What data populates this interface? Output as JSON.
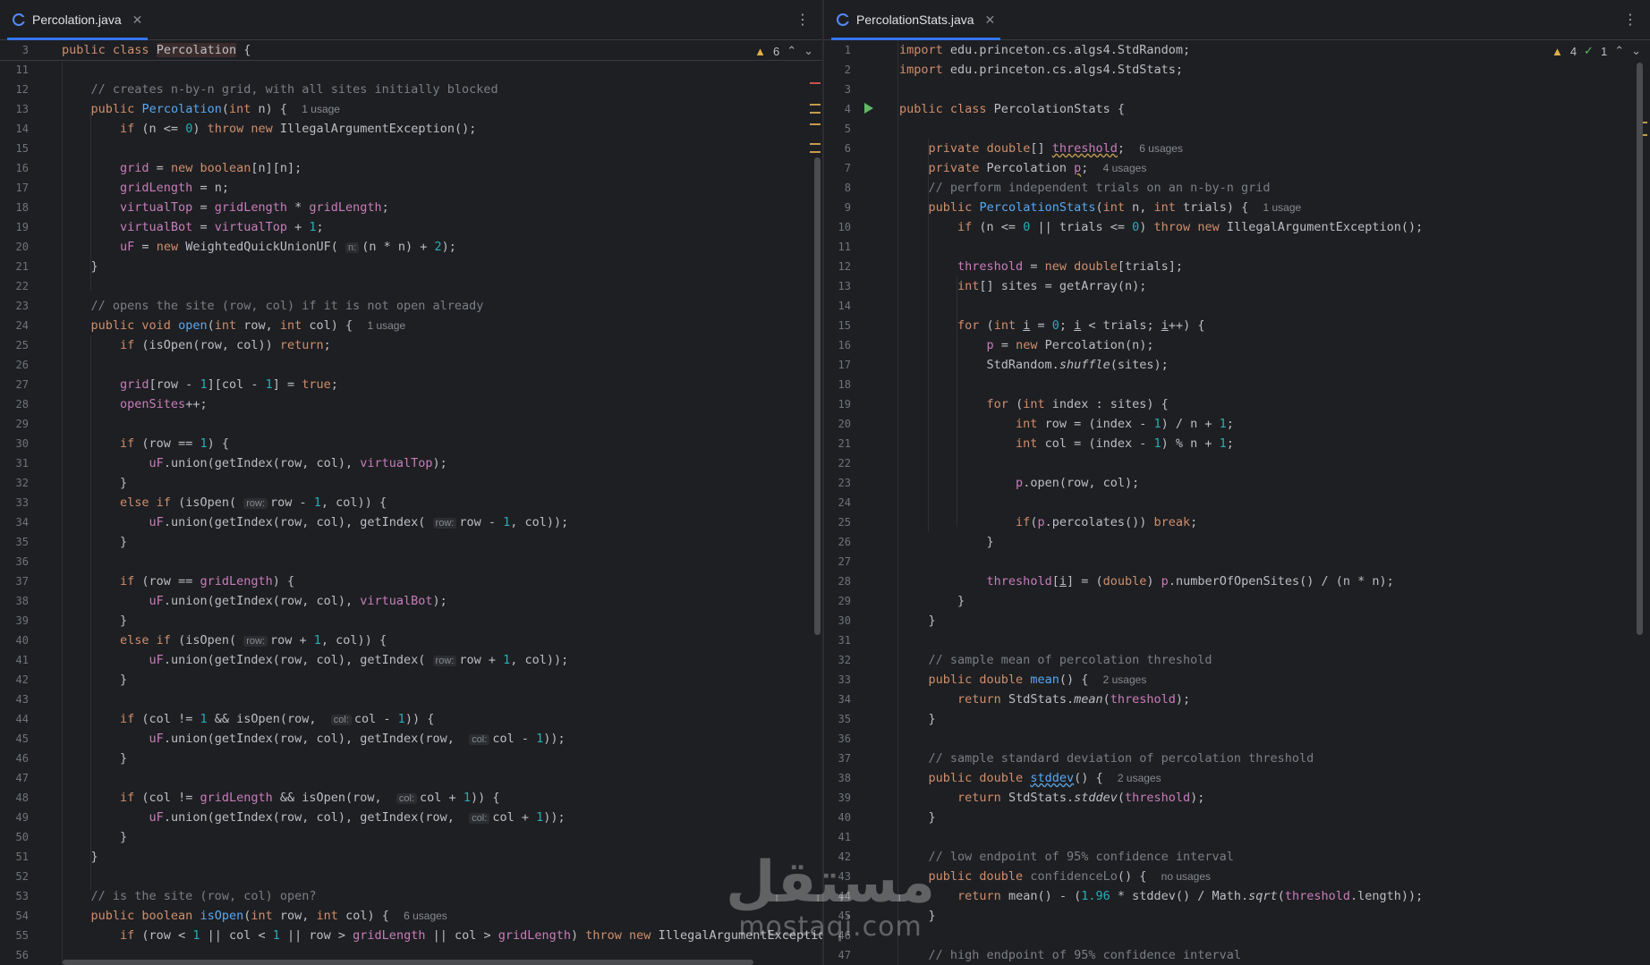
{
  "left": {
    "tab_title": "Percolation.java",
    "sticky_line_no": "3",
    "warnings": "6",
    "lines": [
      {
        "n": "11",
        "html": ""
      },
      {
        "n": "12",
        "html": "    <span class='cm'>// creates n-by-n grid, with all sites initially blocked</span>"
      },
      {
        "n": "13",
        "html": "    <span class='kw'>public</span> <span class='fn'>Percolation</span>(<span class='ty'>int</span> n) {  <span class='hint'>1 usage</span>"
      },
      {
        "n": "14",
        "html": "        <span class='kw'>if</span> (n &lt;= <span class='num'>0</span>) <span class='kw'>throw new</span> IllegalArgumentException();"
      },
      {
        "n": "15",
        "html": ""
      },
      {
        "n": "16",
        "html": "        <span class='fld'>grid</span> = <span class='kw'>new</span> <span class='ty'>boolean</span>[n][n];"
      },
      {
        "n": "17",
        "html": "        <span class='fld'>gridLength</span> = n;"
      },
      {
        "n": "18",
        "html": "        <span class='fld'>virtualTop</span> = <span class='fld'>gridLength</span> * <span class='fld'>gridLength</span>;"
      },
      {
        "n": "19",
        "html": "        <span class='fld'>virtualBot</span> = <span class='fld'>virtualTop</span> + <span class='num'>1</span>;"
      },
      {
        "n": "20",
        "html": "        <span class='fld'>uF</span> = <span class='kw'>new</span> WeightedQuickUnionUF( <span class='inl'>n:</span>(n * n) + <span class='num'>2</span>);"
      },
      {
        "n": "21",
        "html": "    }"
      },
      {
        "n": "22",
        "html": ""
      },
      {
        "n": "23",
        "html": "    <span class='cm'>// opens the site (row, col) if it is not open already</span>"
      },
      {
        "n": "24",
        "html": "    <span class='kw'>public void</span> <span class='fn'>open</span>(<span class='ty'>int</span> row, <span class='ty'>int</span> col) {  <span class='hint'>1 usage</span>"
      },
      {
        "n": "25",
        "html": "        <span class='kw'>if</span> (isOpen(row, col)) <span class='kw'>return</span>;"
      },
      {
        "n": "26",
        "html": ""
      },
      {
        "n": "27",
        "html": "        <span class='fld'>grid</span>[row - <span class='num'>1</span>][col - <span class='num'>1</span>] = <span class='kw'>true</span>;"
      },
      {
        "n": "28",
        "html": "        <span class='fld'>openSites</span>++;"
      },
      {
        "n": "29",
        "html": ""
      },
      {
        "n": "30",
        "html": "        <span class='kw'>if</span> (row == <span class='num'>1</span>) {"
      },
      {
        "n": "31",
        "html": "            <span class='fld'>uF</span>.union(getIndex(row, col), <span class='fld'>virtualTop</span>);"
      },
      {
        "n": "32",
        "html": "        }"
      },
      {
        "n": "33",
        "html": "        <span class='kw'>else if</span> (isOpen( <span class='inl'>row:</span>row - <span class='num'>1</span>, col)) {"
      },
      {
        "n": "34",
        "html": "            <span class='fld'>uF</span>.union(getIndex(row, col), getIndex( <span class='inl'>row:</span>row - <span class='num'>1</span>, col));"
      },
      {
        "n": "35",
        "html": "        }"
      },
      {
        "n": "36",
        "html": ""
      },
      {
        "n": "37",
        "html": "        <span class='kw'>if</span> (row == <span class='fld'>gridLength</span>) {"
      },
      {
        "n": "38",
        "html": "            <span class='fld'>uF</span>.union(getIndex(row, col), <span class='fld'>virtualBot</span>);"
      },
      {
        "n": "39",
        "html": "        }"
      },
      {
        "n": "40",
        "html": "        <span class='kw'>else if</span> (isOpen( <span class='inl'>row:</span>row + <span class='num'>1</span>, col)) {"
      },
      {
        "n": "41",
        "html": "            <span class='fld'>uF</span>.union(getIndex(row, col), getIndex( <span class='inl'>row:</span>row + <span class='num'>1</span>, col));"
      },
      {
        "n": "42",
        "html": "        }"
      },
      {
        "n": "43",
        "html": ""
      },
      {
        "n": "44",
        "html": "        <span class='kw'>if</span> (col != <span class='num'>1</span> &amp;&amp; isOpen(row,  <span class='inl'>col:</span>col - <span class='num'>1</span>)) {"
      },
      {
        "n": "45",
        "html": "            <span class='fld'>uF</span>.union(getIndex(row, col), getIndex(row,  <span class='inl'>col:</span>col - <span class='num'>1</span>));"
      },
      {
        "n": "46",
        "html": "        }"
      },
      {
        "n": "47",
        "html": ""
      },
      {
        "n": "48",
        "html": "        <span class='kw'>if</span> (col != <span class='fld'>gridLength</span> &amp;&amp; isOpen(row,  <span class='inl'>col:</span>col + <span class='num'>1</span>)) {"
      },
      {
        "n": "49",
        "html": "            <span class='fld'>uF</span>.union(getIndex(row, col), getIndex(row,  <span class='inl'>col:</span>col + <span class='num'>1</span>));"
      },
      {
        "n": "50",
        "html": "        }"
      },
      {
        "n": "51",
        "html": "    }"
      },
      {
        "n": "52",
        "html": ""
      },
      {
        "n": "53",
        "html": "    <span class='cm'>// is the site (row, col) open?</span>"
      },
      {
        "n": "54",
        "html": "    <span class='kw'>public boolean</span> <span class='fn'>isOpen</span>(<span class='ty'>int</span> row, <span class='ty'>int</span> col) {  <span class='hint'>6 usages</span>"
      },
      {
        "n": "55",
        "html": "        <span class='kw'>if</span> (row &lt; <span class='num'>1</span> || col &lt; <span class='num'>1</span> || row &gt; <span class='fld'>gridLength</span> || col &gt; <span class='fld'>gridLength</span>) <span class='kw'>throw new</span> IllegalArgumentException"
      },
      {
        "n": "56",
        "html": ""
      }
    ]
  },
  "right": {
    "tab_title": "PercolationStats.java",
    "warnings": "4",
    "checks": "1",
    "lines": [
      {
        "n": "1",
        "html": "<span class='kw'>import</span> edu.princeton.cs.algs4.StdRandom;"
      },
      {
        "n": "2",
        "html": "<span class='kw'>import</span> edu.princeton.cs.algs4.StdStats;"
      },
      {
        "n": "3",
        "html": ""
      },
      {
        "n": "4",
        "html": "<span class='kw'>public class</span> PercolationStats {"
      },
      {
        "n": "5",
        "html": ""
      },
      {
        "n": "6",
        "html": "    <span class='kw'>private</span> <span class='ty'>double</span>[] <span class='fld warnul'>threshold</span>;  <span class='hint'>6 usages</span>"
      },
      {
        "n": "7",
        "html": "    <span class='kw'>private</span> Percolation <span class='fld warnul'>p</span>;  <span class='hint'>4 usages</span>"
      },
      {
        "n": "8",
        "html": "    <span class='cm'>// perform independent trials on an n-by-n grid</span>"
      },
      {
        "n": "9",
        "html": "    <span class='kw'>public</span> <span class='fn'>PercolationStats</span>(<span class='ty'>int</span> n, <span class='ty'>int</span> trials) {  <span class='hint'>1 usage</span>"
      },
      {
        "n": "10",
        "html": "        <span class='kw'>if</span> (n &lt;= <span class='num'>0</span> || trials &lt;= <span class='num'>0</span>) <span class='kw'>throw new</span> IllegalArgumentException();"
      },
      {
        "n": "11",
        "html": ""
      },
      {
        "n": "12",
        "html": "        <span class='fld'>threshold</span> = <span class='kw'>new</span> <span class='ty'>double</span>[trials];"
      },
      {
        "n": "13",
        "html": "        <span class='ty'>int</span>[] sites = getArray(n);"
      },
      {
        "n": "14",
        "html": ""
      },
      {
        "n": "15",
        "html": "        <span class='kw'>for</span> (<span class='ty'>int</span> <span class='ul'>i</span> = <span class='num'>0</span>; <span class='ul'>i</span> &lt; trials; <span class='ul'>i</span>++) {"
      },
      {
        "n": "16",
        "html": "            <span class='fld'>p</span> = <span class='kw'>new</span> Percolation(n);"
      },
      {
        "n": "17",
        "html": "            StdRandom.<span class='it'>shuffle</span>(sites);"
      },
      {
        "n": "18",
        "html": ""
      },
      {
        "n": "19",
        "html": "            <span class='kw'>for</span> (<span class='ty'>int</span> index : sites) {"
      },
      {
        "n": "20",
        "html": "                <span class='ty'>int</span> row = (index - <span class='num'>1</span>) / n + <span class='num'>1</span>;"
      },
      {
        "n": "21",
        "html": "                <span class='ty'>int</span> col = (index - <span class='num'>1</span>) % n + <span class='num'>1</span>;"
      },
      {
        "n": "22",
        "html": ""
      },
      {
        "n": "23",
        "html": "                <span class='fld'>p</span>.open(row, col);"
      },
      {
        "n": "24",
        "html": ""
      },
      {
        "n": "25",
        "html": "                <span class='kw'>if</span>(<span class='fld'>p</span>.percolates()) <span class='kw'>break</span>;"
      },
      {
        "n": "26",
        "html": "            }"
      },
      {
        "n": "27",
        "html": ""
      },
      {
        "n": "28",
        "html": "            <span class='fld'>threshold</span>[<span class='ul'>i</span>] = (<span class='ty'>double</span>) <span class='fld'>p</span>.numberOfOpenSites() / (n * n);"
      },
      {
        "n": "29",
        "html": "        }"
      },
      {
        "n": "30",
        "html": "    }"
      },
      {
        "n": "31",
        "html": ""
      },
      {
        "n": "32",
        "html": "    <span class='cm'>// sample mean of percolation threshold</span>"
      },
      {
        "n": "33",
        "html": "    <span class='kw'>public double</span> <span class='fn'>mean</span>() {  <span class='hint'>2 usages</span>"
      },
      {
        "n": "34",
        "html": "        <span class='kw'>return</span> StdStats.<span class='it'>mean</span>(<span class='fld'>threshold</span>);"
      },
      {
        "n": "35",
        "html": "    }"
      },
      {
        "n": "36",
        "html": ""
      },
      {
        "n": "37",
        "html": "    <span class='cm'>// sample standard deviation of percolation threshold</span>"
      },
      {
        "n": "38",
        "html": "    <span class='kw'>public double</span> <span class='fn typo'>stddev</span>() {  <span class='hint'>2 usages</span>"
      },
      {
        "n": "39",
        "html": "        <span class='kw'>return</span> StdStats.<span class='it'>stddev</span>(<span class='fld'>threshold</span>);"
      },
      {
        "n": "40",
        "html": "    }"
      },
      {
        "n": "41",
        "html": ""
      },
      {
        "n": "42",
        "html": "    <span class='cm'>// low endpoint of 95% confidence interval</span>"
      },
      {
        "n": "43",
        "html": "    <span class='kw'>public double</span> <span class='cm'>confidenceLo</span>() {  <span class='hint'>no usages</span>"
      },
      {
        "n": "44",
        "html": "        <span class='kw'>return</span> mean() - (<span class='num'>1.96</span> * stddev() / Math.<span class='it'>sqrt</span>(<span class='fld'>threshold</span>.length));"
      },
      {
        "n": "45",
        "html": "    }"
      },
      {
        "n": "46",
        "html": ""
      },
      {
        "n": "47",
        "html": "    <span class='cm'>// high endpoint of 95% confidence interval</span>"
      }
    ]
  },
  "watermark": {
    "arabic": "مستقل",
    "latin": "mostaqi.com"
  },
  "colors": {
    "bg": "#1e1f22",
    "keyword": "#cf8e6d",
    "field": "#c77dbb",
    "function": "#56a8f5",
    "number": "#2aacb8",
    "comment": "#7a7e85",
    "accent": "#3574f0"
  }
}
